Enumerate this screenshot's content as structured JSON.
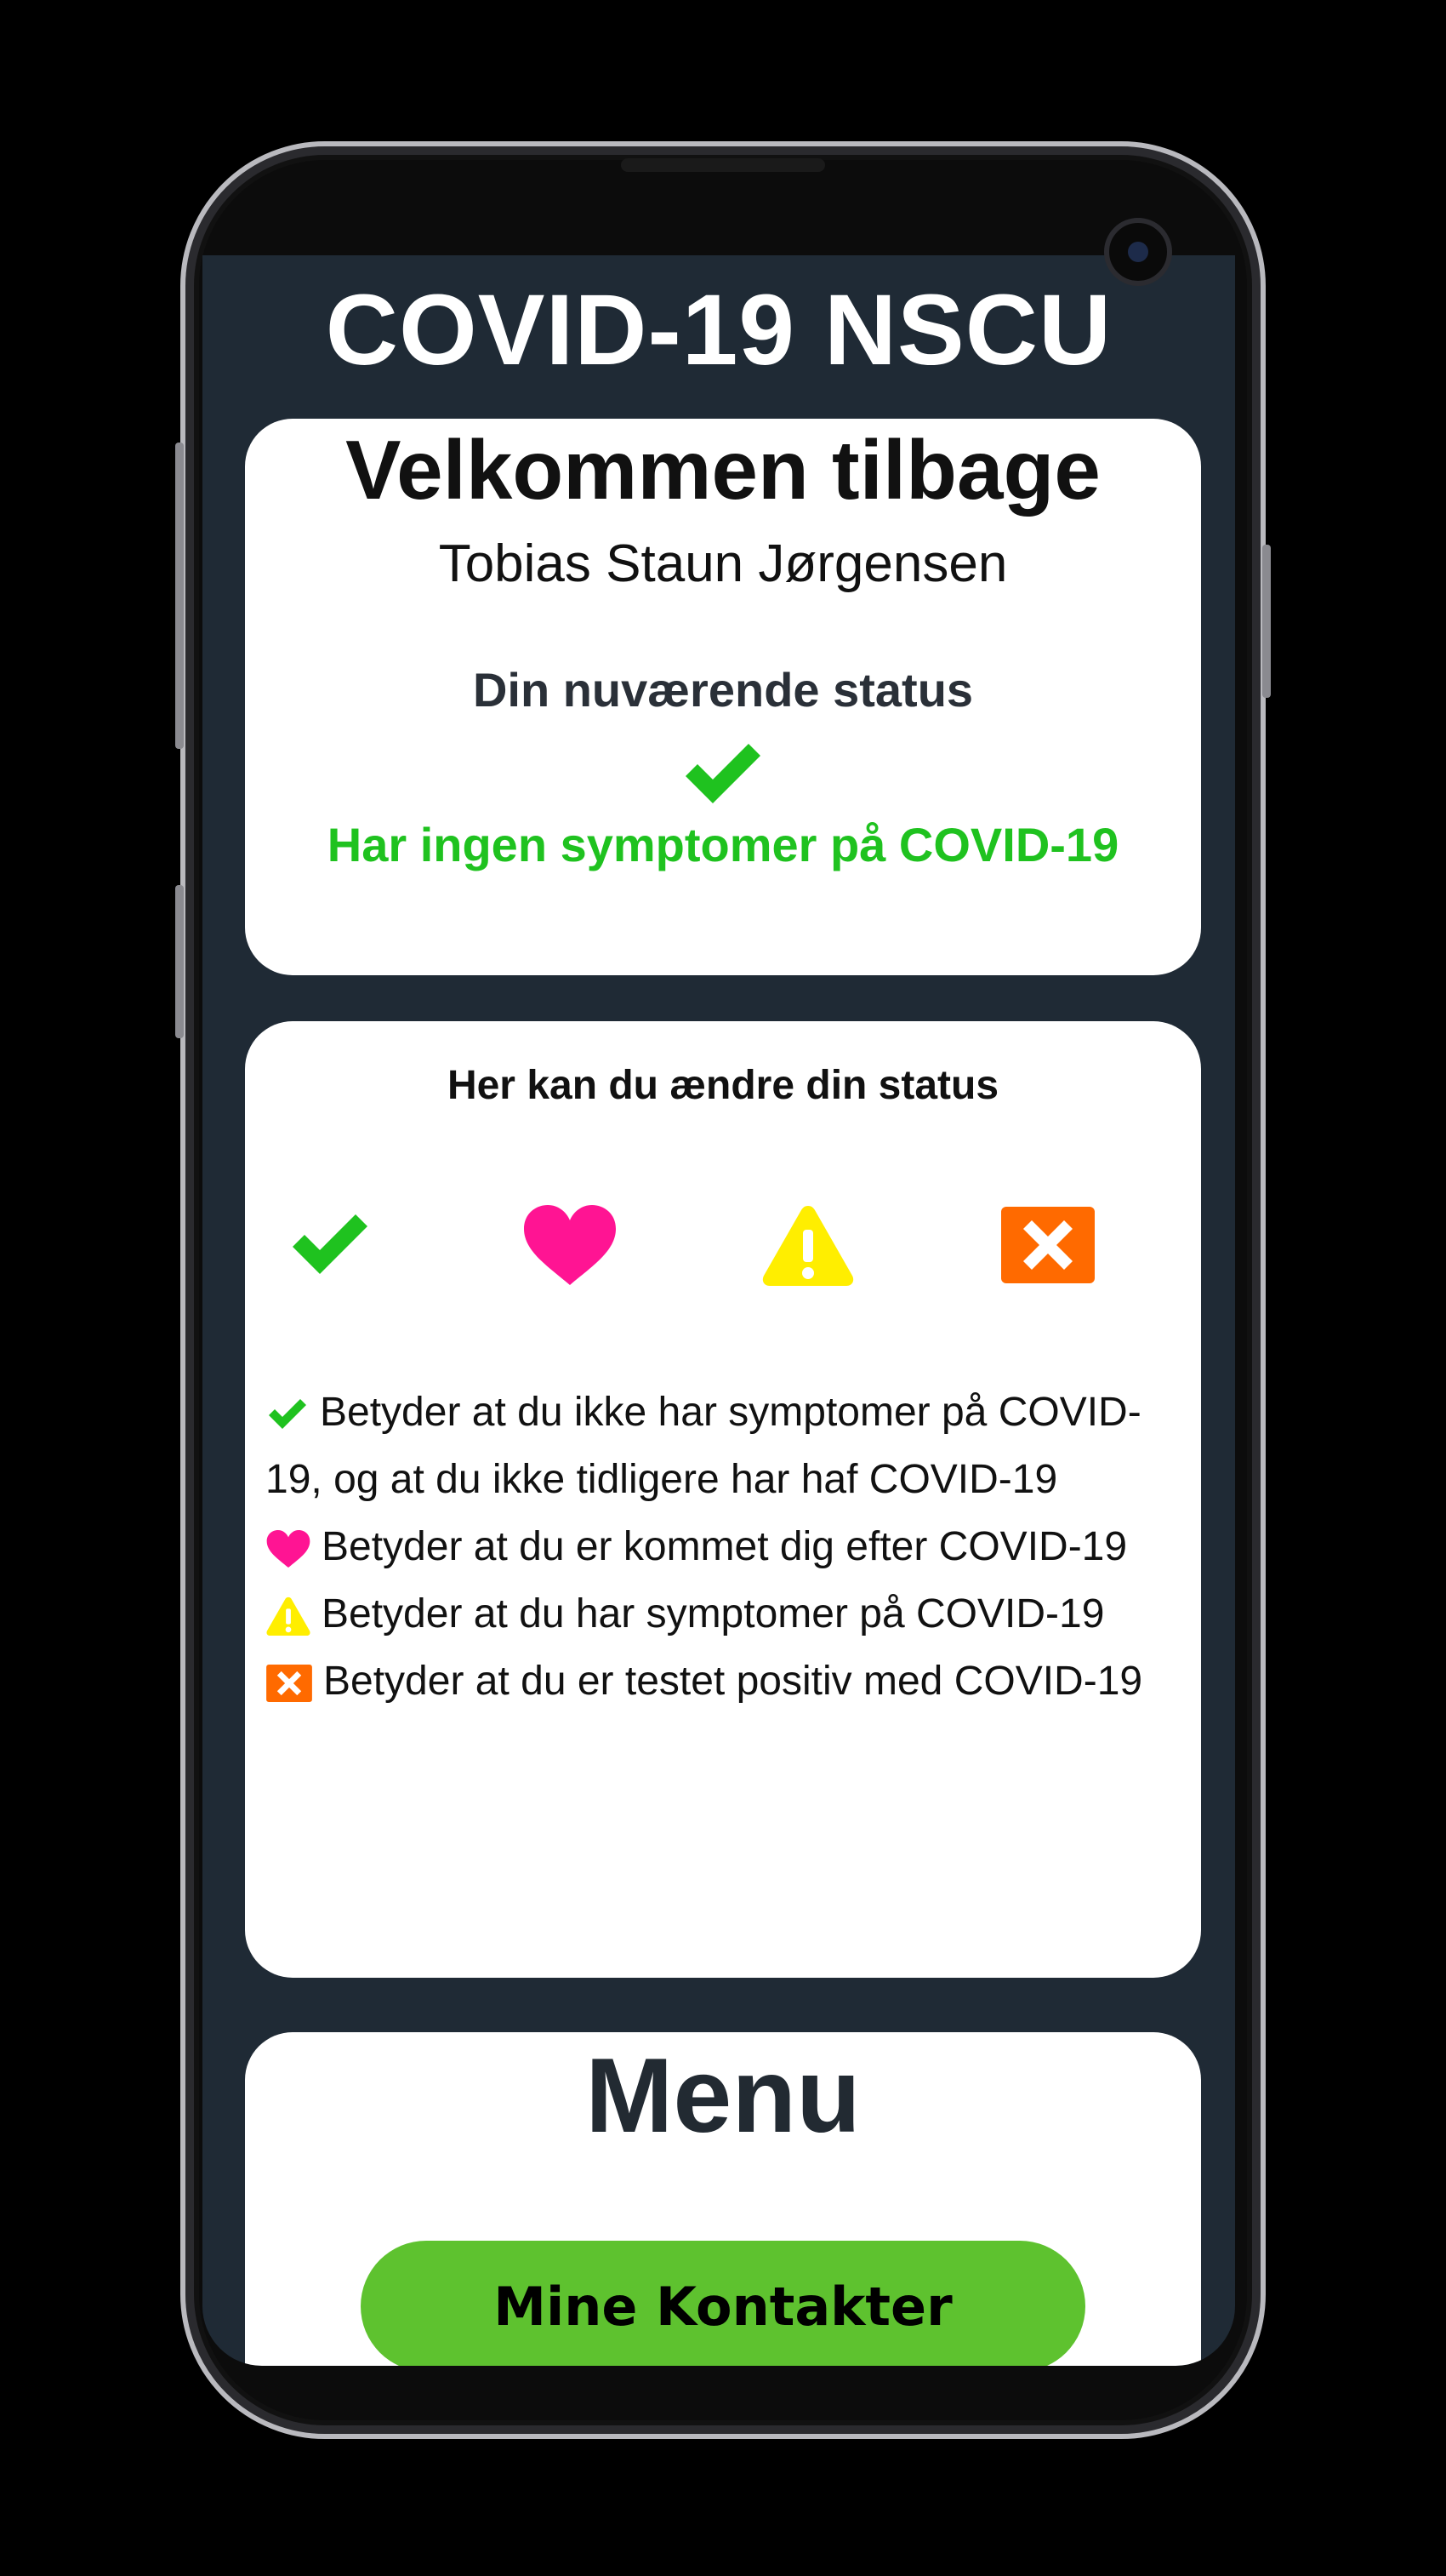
{
  "app": {
    "title": "COVID-19 NSCU"
  },
  "welcome": {
    "title": "Velkommen tilbage",
    "user_name": "Tobias Staun Jørgensen",
    "status_label": "Din nuværende status",
    "status_icon": "check-icon",
    "status_text": "Har ingen symptomer på COVID-19"
  },
  "change_status": {
    "title": "Her kan du ændre din status",
    "options": [
      {
        "icon": "check-icon",
        "color": "#1fc21f"
      },
      {
        "icon": "heart-icon",
        "color": "#ff1493"
      },
      {
        "icon": "warning-icon",
        "color": "#ffee00"
      },
      {
        "icon": "close-box-icon",
        "color": "#ff6a00"
      }
    ],
    "legend": [
      {
        "icon": "check-icon",
        "text": "Betyder at du ikke har symptomer på COVID-19, og at du ikke tidligere har haf COVID-19"
      },
      {
        "icon": "heart-icon",
        "text": "Betyder at du er kommet dig efter COVID-19"
      },
      {
        "icon": "warning-icon",
        "text": "Betyder at du har symptomer på COVID-19"
      },
      {
        "icon": "close-box-icon",
        "text": "Betyder at du er testet positiv med COVID-19"
      }
    ]
  },
  "menu": {
    "title": "Menu",
    "contacts_label": "Mine Kontakter"
  },
  "colors": {
    "background": "#1f2a35",
    "accent_green": "#1fc21f",
    "button_green": "#5ec22f"
  }
}
